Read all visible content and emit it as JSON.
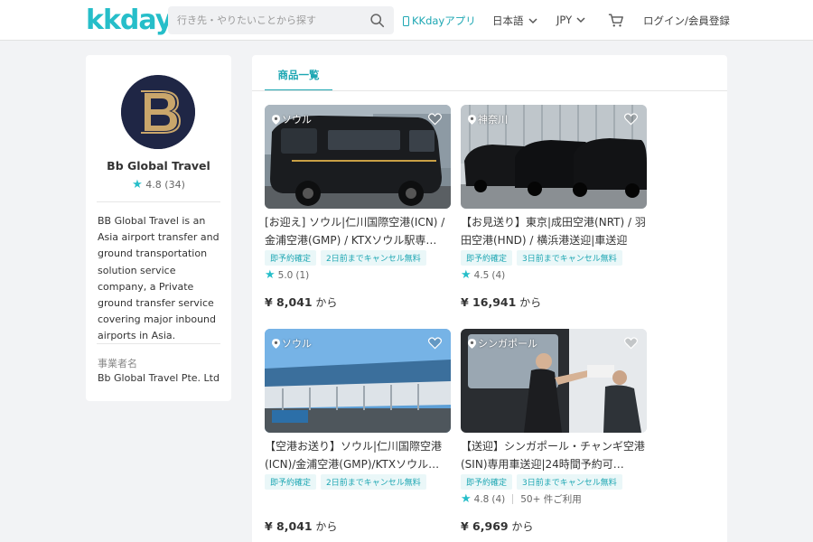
{
  "header": {
    "logo": "kkday",
    "search_placeholder": "行き先・やりたいことから探す",
    "app_link": "KKdayアプリ",
    "language": "日本語",
    "currency": "JPY",
    "login": "ログイン/会員登録",
    "accent_color": "#26bec9"
  },
  "profile": {
    "name": "Bb Global Travel",
    "rating": "4.8",
    "reviews": "(34)",
    "description": "BB Global Travel is an Asia airport transfer and ground transportation solution service company, a Private ground transfer service covering major inbound airports in Asia.",
    "business_label": "事業者名",
    "business_name": "Bb Global Travel Pte. Ltd"
  },
  "tabs": {
    "products": "商品一覧"
  },
  "products": [
    {
      "location": "ソウル",
      "title": "[お迎え] ソウル|仁川国際空港(ICN) / 金浦空港(GMP) / KTXソウル駅専…",
      "tags": [
        "即予約確定",
        "2日前までキャンセル無料"
      ],
      "rating": "5.0",
      "reviews": "(1)",
      "sold": "",
      "price": "¥ 8,041",
      "price_suffix": "から"
    },
    {
      "location": "神奈川",
      "title": "【お見送り】東京|成田空港(NRT) / 羽田空港(HND) / 横浜港送迎|車送迎",
      "tags": [
        "即予約確定",
        "3日前までキャンセル無料"
      ],
      "rating": "4.5",
      "reviews": "(4)",
      "sold": "",
      "price": "¥ 16,941",
      "price_suffix": "から"
    },
    {
      "location": "ソウル",
      "title": "【空港お送り】ソウル|仁川国際空港(ICN)/金浦空港(GMP)/KTXソウル…",
      "tags": [
        "即予約確定",
        "2日前までキャンセル無料"
      ],
      "rating": "",
      "reviews": "",
      "sold": "",
      "price": "¥ 8,041",
      "price_suffix": "から"
    },
    {
      "location": "シンガポール",
      "title": "【送迎】シンガポール・チャンギ空港(SIN)専用車送迎|24時間予約可…",
      "tags": [
        "即予約確定",
        "3日前までキャンセル無料"
      ],
      "rating": "4.8",
      "reviews": "(4)",
      "sold": "50+ 件ご利用",
      "price": "¥ 6,969",
      "price_suffix": "から"
    }
  ]
}
